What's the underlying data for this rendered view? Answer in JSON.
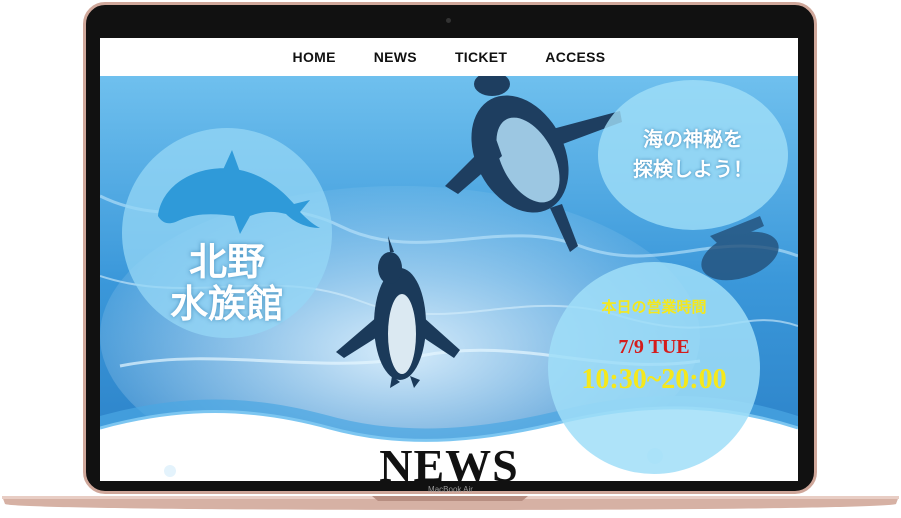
{
  "nav": {
    "items": [
      "HOME",
      "NEWS",
      "TICKET",
      "ACCESS"
    ]
  },
  "hero": {
    "logo_line1": "北野",
    "logo_line2": "水族館",
    "catch_line1": "海の神秘を",
    "catch_line2": "探検しよう！",
    "hours_title": "本日の営業時間",
    "hours_date": "7/9 TUE",
    "hours_time": "10:30~20:00"
  },
  "section": {
    "news_heading": "NEWS"
  },
  "device": {
    "brand": "MacBook Air"
  },
  "colors": {
    "accent_yellow": "#f5e81c",
    "accent_red": "#d41c1c",
    "water_blue": "#2f8ed6",
    "bezel_rose_gold": "#cfa79a"
  }
}
